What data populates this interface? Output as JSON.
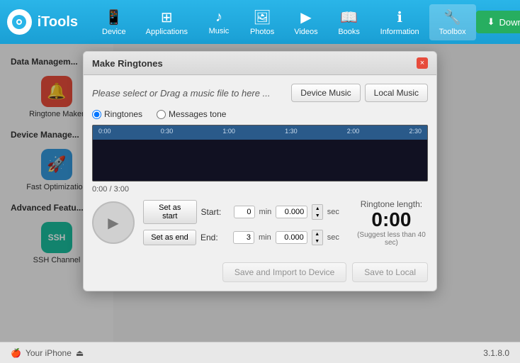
{
  "app": {
    "name": "iTools",
    "version": "3.1.8.0"
  },
  "topbar": {
    "download_label": "Download",
    "nav_items": [
      {
        "id": "device",
        "label": "Device",
        "icon": "📱"
      },
      {
        "id": "applications",
        "label": "Applications",
        "icon": "⊞"
      },
      {
        "id": "music",
        "label": "Music",
        "icon": "♪"
      },
      {
        "id": "photos",
        "label": "Photos",
        "icon": "🖼"
      },
      {
        "id": "videos",
        "label": "Videos",
        "icon": "▶"
      },
      {
        "id": "books",
        "label": "Books",
        "icon": "📖"
      },
      {
        "id": "information",
        "label": "Information",
        "icon": "ℹ"
      },
      {
        "id": "toolbox",
        "label": "Toolbox",
        "icon": "🔧",
        "active": true
      }
    ]
  },
  "sidebar": {
    "data_management_title": "Data Managem...",
    "device_management_title": "Device Manage...",
    "advanced_features_title": "Advanced Featu...",
    "items": [
      {
        "id": "ringtone-maker",
        "label": "Ringtone Maker",
        "icon": "🔔",
        "color": "red"
      },
      {
        "id": "fast-optimization",
        "label": "Fast Optimization",
        "icon": "🚀",
        "color": "blue"
      },
      {
        "id": "ssh-channel",
        "label": "SSH Channel",
        "icon": "SSH",
        "color": "teal"
      }
    ]
  },
  "modal": {
    "title": "Make Ringtones",
    "close_label": "×",
    "file_select_placeholder": "Please select or Drag a music file to here ...",
    "device_music_label": "Device Music",
    "local_music_label": "Local Music",
    "radio_ringtones": "Ringtones",
    "radio_messages_tone": "Messages tone",
    "timeline_labels": [
      "0:00",
      "0:30",
      "1:00",
      "1:30",
      "2:00",
      "2:30"
    ],
    "time_display": "0:00 / 3:00",
    "set_as_start_label": "Set as start",
    "set_as_end_label": "Set as end",
    "start_label": "Start:",
    "end_label": "End:",
    "start_min_value": "0",
    "start_sec_value": "0.000",
    "end_min_value": "3",
    "end_sec_value": "0.000",
    "min_unit": "min",
    "sec_unit": "sec",
    "ringtone_length_label": "Ringtone length:",
    "ringtone_time": "0:00",
    "suggest_text": "(Suggest less than 40 sec)",
    "save_import_label": "Save and Import to Device",
    "save_local_label": "Save to Local"
  },
  "bottombar": {
    "device_name": "Your iPhone",
    "version": "3.1.8.0"
  },
  "colors": {
    "topbar_bg": "#2ab5e8",
    "active_nav": "rgba(255,255,255,0.25)",
    "download_btn": "#27ae60"
  }
}
